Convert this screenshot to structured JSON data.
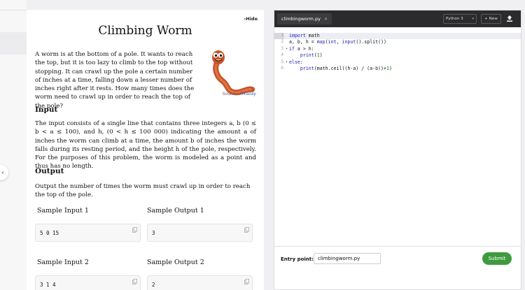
{
  "problem": {
    "hide_label": "Hide",
    "title": "Climbing Worm",
    "image_source_prefix": "Source:",
    "image_source_link": "Pixabay",
    "intro": "A worm is at the bottom of a pole. It wants to reach the top, but it is too lazy to climb to the top without stopping. It can crawl up the pole a certain number of inches at a time, falling down a lesser number of inches right after it rests. How many times does the worm need to crawl up in order to reach the top of the pole?",
    "input_heading": "Input",
    "input_text": "The input consists of a single line that contains three integers a, b (0 ≤ b < a ≤ 100), and h, (0 < h ≤ 100 000) indicating the amount a of inches the worm can climb at a time, the amount b of inches the worm falls during its resting period, and the height h of the pole, respectively. For the purposes of this problem, the worm is modeled as a point and thus has no length.",
    "output_heading": "Output",
    "output_text": "Output the number of times the worm must crawl up in order to reach the top of the pole.",
    "samples": [
      {
        "input_label": "Sample Input 1",
        "input": "5 0 15",
        "output_label": "Sample Output 1",
        "output": "3"
      },
      {
        "input_label": "Sample Input 2",
        "input": "3 1 4",
        "output_label": "Sample Output 2",
        "output": "2"
      }
    ]
  },
  "editor": {
    "tab_name": "climbingworm.py",
    "tab_close": "×",
    "language": "Python 3",
    "new_label": "+ New",
    "line_numbers": [
      "1",
      "2",
      "3",
      "4",
      "5",
      "6"
    ],
    "lines": [
      [
        {
          "t": "import",
          "c": "kw"
        },
        {
          "t": " math",
          "c": "txt"
        }
      ],
      [
        {
          "t": "a, b, h = ",
          "c": "txt"
        },
        {
          "t": "map",
          "c": "kw"
        },
        {
          "t": "(",
          "c": "txt"
        },
        {
          "t": "int",
          "c": "kw"
        },
        {
          "t": ", ",
          "c": "txt"
        },
        {
          "t": "input",
          "c": "kw"
        },
        {
          "t": "().split())",
          "c": "txt"
        }
      ],
      [
        {
          "t": "if",
          "c": "kw"
        },
        {
          "t": " a > h:",
          "c": "txt"
        }
      ],
      [
        {
          "t": "    ",
          "c": "txt"
        },
        {
          "t": "print",
          "c": "kw"
        },
        {
          "t": "(",
          "c": "txt"
        },
        {
          "t": "1",
          "c": "num"
        },
        {
          "t": ")",
          "c": "txt"
        }
      ],
      [
        {
          "t": "else",
          "c": "kw"
        },
        {
          "t": ":",
          "c": "txt"
        }
      ],
      [
        {
          "t": "    ",
          "c": "txt"
        },
        {
          "t": "print",
          "c": "kw"
        },
        {
          "t": "(math.ceil((h-a) / (a-b))+",
          "c": "txt"
        },
        {
          "t": "1",
          "c": "num"
        },
        {
          "t": ")",
          "c": "txt"
        }
      ]
    ],
    "entry_label": "Entry point:",
    "entry_value": "climbingworm.py",
    "submit_label": "Submit"
  },
  "colors": {
    "submit": "#3f9a3f",
    "editor_header": "#2b2b2d",
    "worm": "#c8532a"
  }
}
